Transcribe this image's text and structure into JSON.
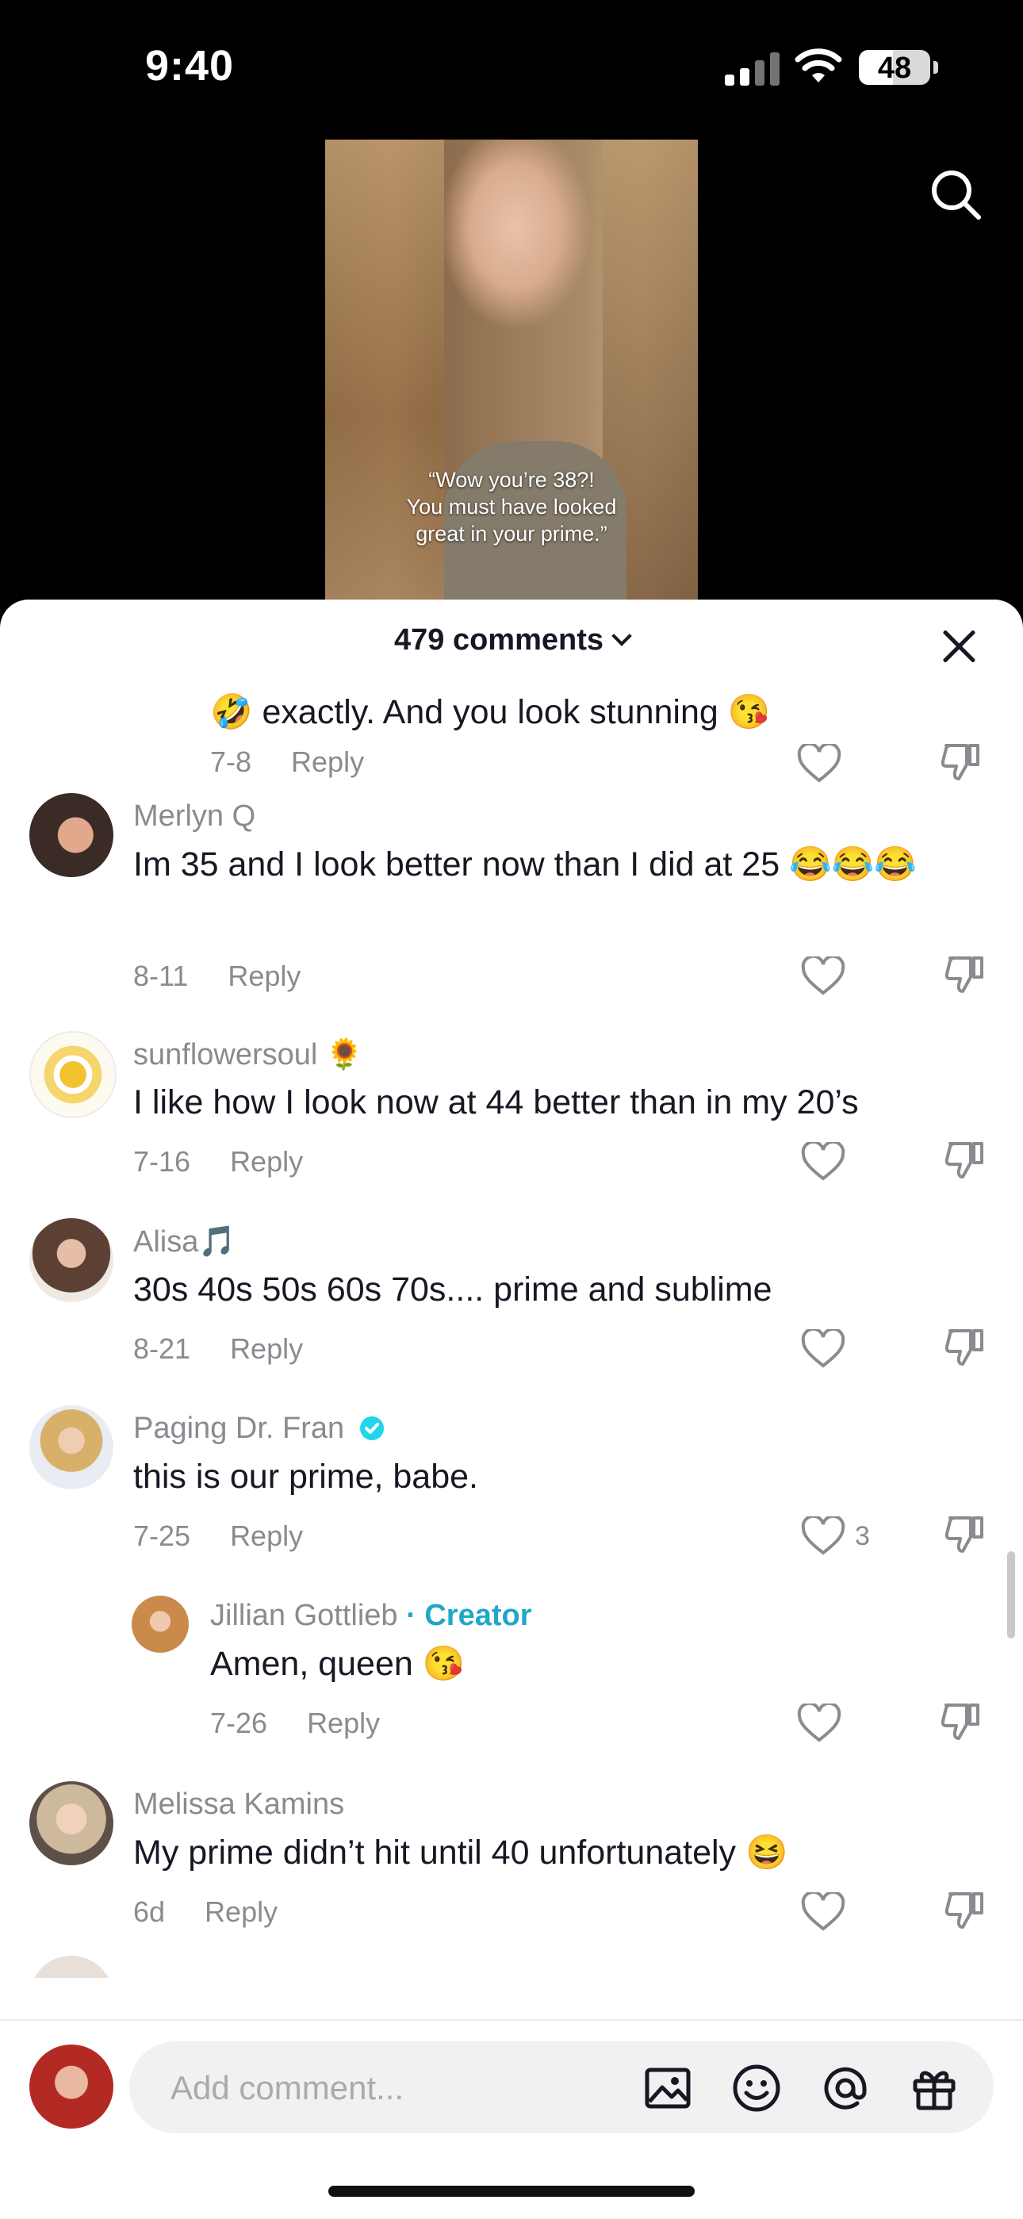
{
  "status_bar": {
    "time": "9:40",
    "battery": "48"
  },
  "video": {
    "caption_lines": [
      "“Wow you’re 38?!",
      "You must have looked",
      "great in your prime.”"
    ]
  },
  "sheet": {
    "title": "479 comments"
  },
  "comments": [
    {
      "username": "",
      "text": "🤣 exactly. And you look stunning 😘",
      "date": "7-8",
      "reply_label": "Reply",
      "likes": ""
    },
    {
      "username": "Merlyn Q",
      "text": "Im 35 and I look better now than I did at 25 😂😂😂",
      "date": "8-11",
      "reply_label": "Reply",
      "likes": ""
    },
    {
      "username": "sunflowersoul 🌻",
      "text": "I like how I look now at 44 better than in my 20’s",
      "date": "7-16",
      "reply_label": "Reply",
      "likes": ""
    },
    {
      "username": "Alisa🎵",
      "text": "30s 40s 50s 60s 70s.... prime and sublime",
      "date": "8-21",
      "reply_label": "Reply",
      "likes": ""
    },
    {
      "username": "Paging Dr. Fran",
      "text": "this is our prime, babe.",
      "date": "7-25",
      "reply_label": "Reply",
      "likes": "3"
    },
    {
      "username": "Jillian Gottlieb",
      "creator_label": "· Creator",
      "text": "Amen, queen 😘",
      "date": "7-26",
      "reply_label": "Reply",
      "likes": ""
    },
    {
      "username": "Melissa Kamins",
      "text": "My prime didn’t hit until 40 unfortunately 😆",
      "date": "6d",
      "reply_label": "Reply",
      "likes": ""
    }
  ],
  "composer": {
    "placeholder": "Add comment..."
  },
  "colors": {
    "accent": "#20a7c8",
    "verified": "#20d5ec",
    "muted": "#8a8b91"
  }
}
